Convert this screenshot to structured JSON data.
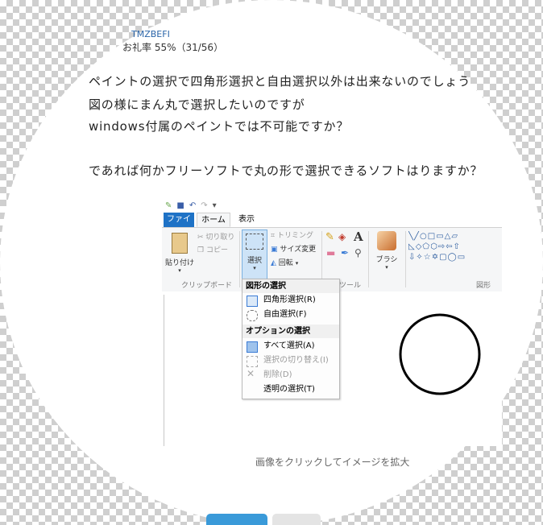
{
  "post": {
    "username": "TMZBEFI",
    "rate": "お礼率 55%（31/56）",
    "question_lines": [
      "ペイントの選択で四角形選択と自由選択以外は出来ないのでしょう",
      "図の様にまん丸で選択したいのですが",
      "windows付属のペイントでは不可能ですか？",
      "であれば何かフリーソフトで丸の形で選択できるソフトはりますか？"
    ],
    "image_caption": "画像をクリックしてイメージを拡大"
  },
  "paint": {
    "tabs": [
      "ファイル",
      "ホーム",
      "表示"
    ],
    "clipboard": {
      "paste": "貼り付け",
      "cut": "切り取り",
      "copy": "コピー",
      "group": "クリップボード"
    },
    "image": {
      "select": "選択",
      "crop": "トリミング",
      "resize": "サイズ変更",
      "rotate": "回転"
    },
    "tools": {
      "text": "A",
      "group": "ツール"
    },
    "brush": "ブラシ",
    "shapes_group": "図形",
    "menu": {
      "header_shape": "図形の選択",
      "rect": "四角形選択(R)",
      "free": "自由選択(F)",
      "header_options": "オプションの選択",
      "select_all": "すべて選択(A)",
      "invert": "選択の切り替え(I)",
      "delete": "削除(D)",
      "transparent": "透明の選択(T)"
    }
  },
  "colors": {
    "accent": "#1e72c6",
    "link": "#2a64a8"
  }
}
